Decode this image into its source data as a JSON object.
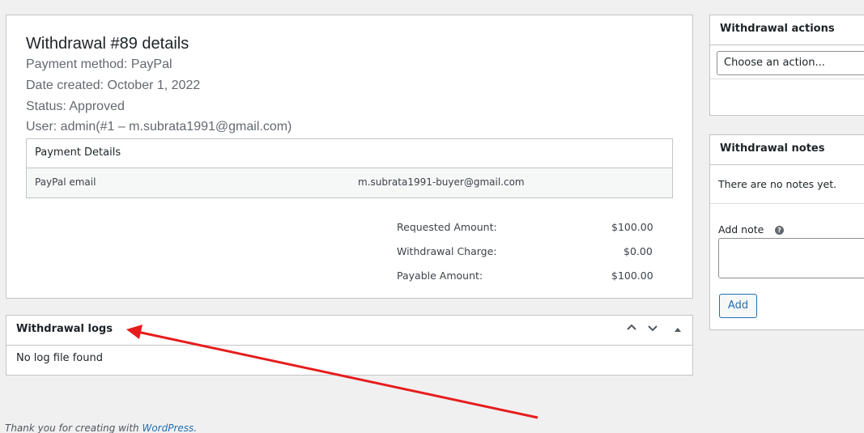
{
  "details": {
    "title": "Withdrawal #89 details",
    "payment_method": "Payment method: PayPal",
    "date_created": "Date created: October 1, 2022",
    "status": "Status: Approved",
    "user": "User: admin(#1 – m.subrata1991@gmail.com)",
    "payment_details_header": "Payment Details",
    "paypal_email_label": "PayPal email",
    "paypal_email_value": "m.subrata1991-buyer@gmail.com",
    "amounts": [
      {
        "label": "Requested Amount:",
        "value": "$100.00"
      },
      {
        "label": "Withdrawal Charge:",
        "value": "$0.00"
      },
      {
        "label": "Payable Amount:",
        "value": "$100.00"
      }
    ]
  },
  "logs": {
    "title": "Withdrawal logs",
    "empty": "No log file found",
    "controls": {
      "up": "⌃",
      "down": "⌄",
      "toggle": "▲"
    }
  },
  "actions": {
    "title": "Withdrawal actions",
    "select_value": "Choose an action..."
  },
  "notes": {
    "title": "Withdrawal notes",
    "empty": "There are no notes yet.",
    "add_note_label": "Add note",
    "help_icon": "?",
    "add_button": "Add"
  },
  "footer": {
    "text": "Thank you for creating with ",
    "link": "WordPress",
    "end": "."
  },
  "annotation": {
    "arrow_color": "#e61c1c"
  }
}
